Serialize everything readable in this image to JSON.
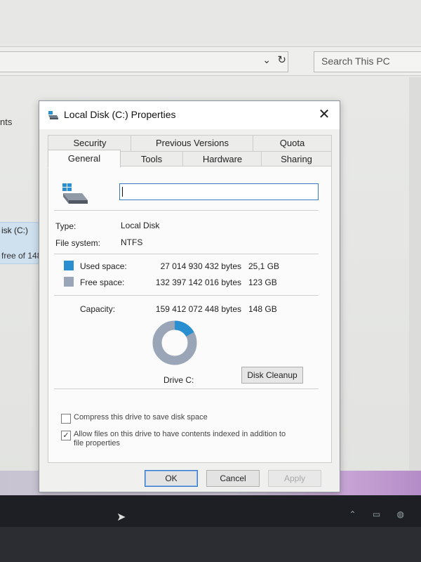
{
  "explorer": {
    "search_placeholder": "Search This PC",
    "nav_fragment": "nts",
    "drive_fragment": "isk (C:)",
    "drive_free_fragment": "free of 148"
  },
  "dialog": {
    "title": "Local Disk (C:) Properties",
    "tabs_row1": [
      "Security",
      "Previous Versions",
      "Quota"
    ],
    "tabs_row2": [
      "General",
      "Tools",
      "Hardware",
      "Sharing"
    ],
    "active_tab": "General",
    "drive_name_value": "",
    "type_label": "Type:",
    "type_value": "Local Disk",
    "fs_label": "File system:",
    "fs_value": "NTFS",
    "used_label": "Used space:",
    "used_bytes": "27 014 930 432 bytes",
    "used_gb": "25,1 GB",
    "free_label": "Free space:",
    "free_bytes": "132 397 142 016 bytes",
    "free_gb": "123 GB",
    "capacity_label": "Capacity:",
    "capacity_bytes": "159 412 072 448 bytes",
    "capacity_gb": "148 GB",
    "used_fraction": 0.169,
    "drive_label": "Drive C:",
    "cleanup_label": "Disk Cleanup",
    "compress_label": "Compress this drive to save disk space",
    "compress_checked": false,
    "index_label_1": "Allow files on this drive to have contents indexed in addition to",
    "index_label_2": "file properties",
    "index_checked": true,
    "ok_label": "OK",
    "cancel_label": "Cancel",
    "apply_label": "Apply"
  },
  "colors": {
    "used": "#2a8fd0",
    "free": "#9aa6b8",
    "accent": "#3c78c8"
  },
  "icons": {
    "close": "close-icon",
    "refresh": "refresh-icon",
    "chevron": "chevron-down-icon",
    "drive": "hard-drive-icon"
  }
}
